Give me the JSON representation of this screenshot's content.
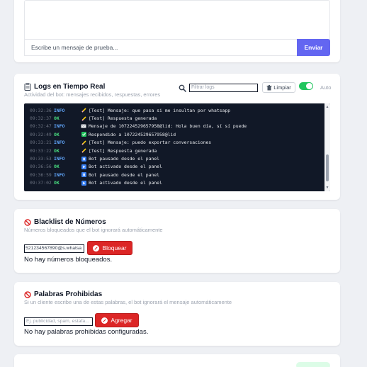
{
  "chat": {
    "input_placeholder": "Escribe un mensaje de prueba...",
    "send_label": "Enviar"
  },
  "logs": {
    "title": "Logs en Tiempo Real",
    "subtitle": "Actividad del bot: mensajes recibidos, respuestas, errores",
    "filter_placeholder": "Filtrar logs",
    "clear_label": "Limpiar",
    "auto_label": "Auto",
    "auto_scroll_on": true,
    "entries": [
      {
        "time": "09:32:36",
        "level": "INFO",
        "icon": "pencil-icon",
        "message": "[Test] Mensaje: que pasa si me insultan por whatsapp"
      },
      {
        "time": "09:32:37",
        "level": "OK",
        "icon": "pencil-icon",
        "message": "[Test] Respuesta generada"
      },
      {
        "time": "09:32:47",
        "level": "INFO",
        "icon": "envelope-icon",
        "message": "Mensaje de 107224529657958@lid: Hola buen día, sí sí puede"
      },
      {
        "time": "09:32:49",
        "level": "OK",
        "icon": "check-square-icon",
        "message": "Respondido a 107224529657958@lid"
      },
      {
        "time": "09:33:21",
        "level": "INFO",
        "icon": "pencil-icon",
        "message": "[Test] Mensaje: puedo exportar conversaciones"
      },
      {
        "time": "09:33:22",
        "level": "OK",
        "icon": "pencil-icon",
        "message": "[Test] Respuesta generada"
      },
      {
        "time": "09:33:53",
        "level": "INFO",
        "icon": "pause-square-icon",
        "message": "Bot pausado desde el panel"
      },
      {
        "time": "09:36:56",
        "level": "OK",
        "icon": "play-square-icon",
        "message": "Bot activado desde el panel"
      },
      {
        "time": "09:36:59",
        "level": "INFO",
        "icon": "pause-square-icon",
        "message": "Bot pausado desde el panel"
      },
      {
        "time": "09:37:02",
        "level": "OK",
        "icon": "play-square-icon",
        "message": "Bot activado desde el panel"
      }
    ]
  },
  "blacklist": {
    "title": "Blacklist de Números",
    "subtitle": "Números bloqueados que el bot ignorará automáticamente",
    "input_value": "5212345678​90@s.whatsa",
    "block_label": "Bloquear",
    "empty_text": "No hay números bloqueados."
  },
  "forbidden": {
    "title": "Palabras Prohibidas",
    "subtitle": "Si un cliente escribe una de estas palabras, el bot ignorará el mensaje automáticamente",
    "input_placeholder": "Ej. publicidad, spam, estafa...",
    "add_label": "Agregar",
    "empty_text": "No hay palabras prohibidas configuradas."
  },
  "colors": {
    "accent": "#6366f1",
    "danger": "#dc2626",
    "success": "#22c55e",
    "terminal_bg": "#111827",
    "info": "#60a5fa",
    "ok": "#4ade80"
  }
}
